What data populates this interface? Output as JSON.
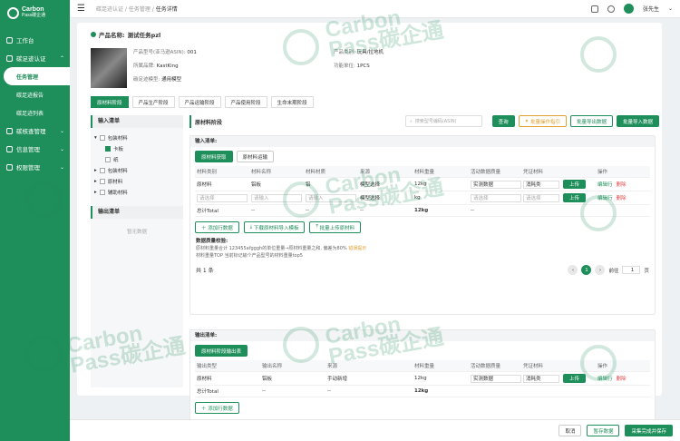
{
  "app": {
    "logo_line1": "Carbon",
    "logo_line2": "Pass碳企通"
  },
  "sidebar": {
    "items": [
      {
        "label": "工作台",
        "expand": ""
      },
      {
        "label": "碳足迹认证",
        "expand": "⌃"
      },
      {
        "label": "任务管理",
        "sub": true,
        "active": true
      },
      {
        "label": "碳足迹报告",
        "sub": true
      },
      {
        "label": "碳足迹列表",
        "sub": true
      },
      {
        "label": "碳核查管理",
        "expand": "⌄"
      },
      {
        "label": "信息管理",
        "expand": "⌄"
      },
      {
        "label": "权限管理",
        "expand": "⌄"
      }
    ]
  },
  "topbar": {
    "breadcrumb": [
      "碳足迹认证",
      "任务管理",
      "任务详情"
    ],
    "sep": "/",
    "user": "张先生"
  },
  "product": {
    "name_label": "产品名称:",
    "name": "测试任务pzl",
    "model_label": "产品型号(亚马逊ASIN):",
    "model": "001",
    "category_label": "产品类别:",
    "category": "玩具/拉地机",
    "brand_label": "所属品牌:",
    "brand": "KastKing",
    "unit_label": "功能单位:",
    "unit": "1PCS",
    "fp_label": "碳足迹模型:",
    "fp": "通用模型"
  },
  "phase_tabs": [
    "原材料阶段",
    "产品生产阶段",
    "产品运输阶段",
    "产品使用阶段",
    "生命末期阶段"
  ],
  "left": {
    "input_title": "输入清单",
    "tree": [
      {
        "label": "包装材料",
        "level": 0,
        "checked": false,
        "toggle": "▾"
      },
      {
        "label": "卡板",
        "level": 1,
        "checked": true
      },
      {
        "label": "纸",
        "level": 1,
        "checked": false
      },
      {
        "label": "包装材料",
        "level": 0,
        "checked": false,
        "toggle": "▸"
      },
      {
        "label": "原材料",
        "level": 0,
        "checked": false,
        "toggle": "▸"
      },
      {
        "label": "辅助材料",
        "level": 0,
        "checked": false,
        "toggle": "▸"
      }
    ],
    "output_title": "输出清单",
    "empty": "暂无数据"
  },
  "right": {
    "title": "原材料阶段",
    "search_placeholder": "搜索型号编码(ASIN)",
    "search_btn": "查询",
    "btn_guide": "批量操作指引",
    "btn_export": "批量导出数据",
    "btn_import": "批量导入数据",
    "input_list": "输入清单:",
    "input_tabs": [
      "原材料获取",
      "原材料运输"
    ],
    "cols": [
      "材料类别",
      "材料名称",
      "材料材质",
      "来源",
      "材料重量",
      "活动数据质量",
      "凭证材料",
      "操作"
    ],
    "total_label": "材料重量",
    "rows": [
      {
        "cat": "原材料",
        "name": "铝板",
        "mat": "铝",
        "src": "模型选择",
        "w": "12kg",
        "q": "实测数据",
        "proof": "消耗类"
      },
      {
        "cat": "请选择",
        "name": "请输入",
        "mat": "请输入",
        "src": "模型选择",
        "w": "kg",
        "q": "请选择",
        "proof": "请选择"
      }
    ],
    "total": {
      "label": "总计Total",
      "a": "--",
      "b": "--",
      "c": "--",
      "d": "--",
      "w": "12kg"
    },
    "upload": "上传",
    "edit": "编辑行",
    "del": "删除",
    "add_row": "添加行数据",
    "dl_tpl": "下载原材料导入模板",
    "bulk_up": "批量上传原材料",
    "check_title": "数据质量校验:",
    "check1": "原材料重量合计 123455afgggh的单位重量→原材料重量之和, 偏差为80%",
    "check1_link": "错误提示",
    "check2": "材料重量TOP 当前标记输个产品型号的材料重量top5",
    "count": "共 1 条",
    "page": "1",
    "goto_label": "前往",
    "goto_val": "1",
    "page_unit": "页",
    "output_list": "输出清单:",
    "output_tab": "原材料阶段输出表",
    "out_cols": [
      "输出类型",
      "输出名称",
      "来源",
      "材料重量",
      "活动数据质量",
      "凭证材料",
      "操作"
    ],
    "out_row": {
      "type": "原材料",
      "name": "铝板",
      "src": "手动新增",
      "w": "12kg",
      "q": "实测数据",
      "proof": "消耗类"
    },
    "out_total": {
      "label": "总计Total",
      "a": "--",
      "b": "--",
      "w": "12kg"
    }
  },
  "footer": {
    "cancel": "取消",
    "save": "暂存数据",
    "finish": "采集完成并保存"
  },
  "watermark": "Pass碳企通"
}
